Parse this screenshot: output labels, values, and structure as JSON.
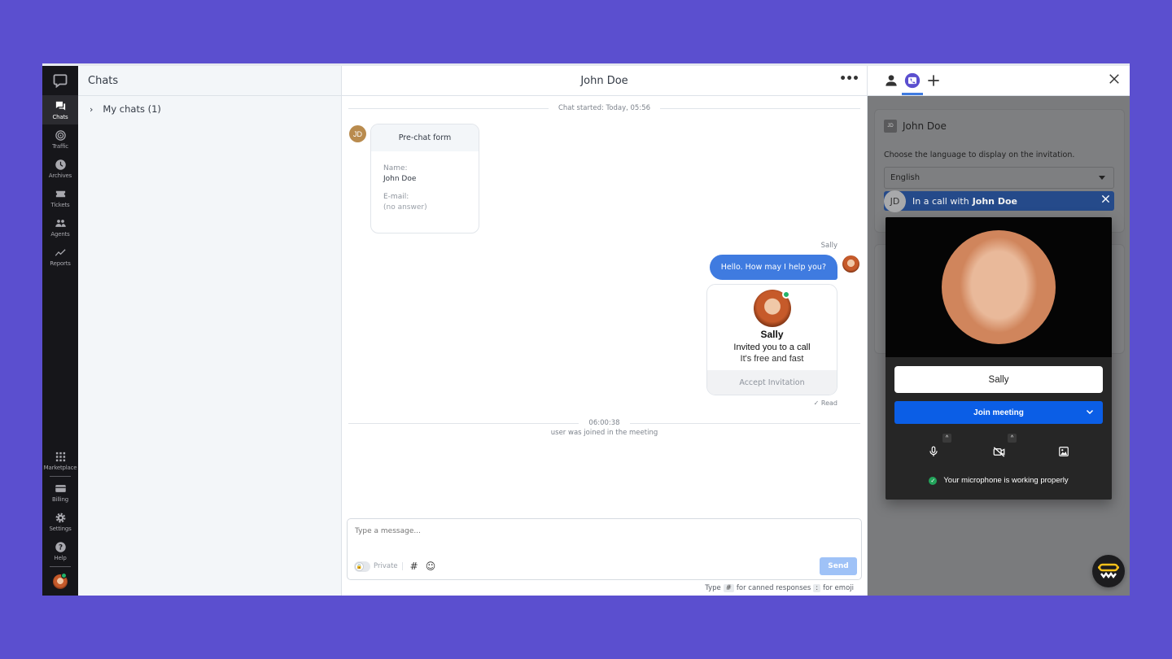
{
  "nav": {
    "items": [
      {
        "label": "Chats",
        "icon": "chats-icon",
        "active": true
      },
      {
        "label": "Traffic",
        "icon": "traffic-icon"
      },
      {
        "label": "Archives",
        "icon": "archives-icon"
      },
      {
        "label": "Tickets",
        "icon": "tickets-icon"
      },
      {
        "label": "Agents",
        "icon": "agents-icon"
      },
      {
        "label": "Reports",
        "icon": "reports-icon"
      }
    ],
    "bottom_items": [
      {
        "label": "Marketplace",
        "icon": "marketplace-icon"
      },
      {
        "label": "Billing",
        "icon": "billing-icon"
      },
      {
        "label": "Settings",
        "icon": "settings-icon"
      },
      {
        "label": "Help",
        "icon": "help-icon"
      }
    ]
  },
  "chats_list": {
    "title": "Chats",
    "groups": [
      {
        "label": "My chats (1)",
        "expanded": false
      }
    ]
  },
  "chat": {
    "title": "John Doe",
    "started": "Chat started: Today, 05:56",
    "visitor_initials": "JD",
    "prechat": {
      "title": "Pre-chat form",
      "fields": [
        {
          "label": "Name:",
          "value": "John Doe"
        },
        {
          "label": "E-mail:",
          "value": "(no answer)"
        }
      ]
    },
    "agent_name": "Sally",
    "message": "Hello. How may I help you?",
    "invite": {
      "name": "Sally",
      "line1": "Invited you to a call",
      "line2": "It's free and fast",
      "accept": "Accept Invitation"
    },
    "read_status": "✓ Read",
    "event_time": "06:00:38",
    "event_text": "user was joined in the meeting",
    "composer": {
      "placeholder": "Type a message...",
      "private_label": "Private",
      "send_label": "Send"
    },
    "hint": {
      "type": "Type",
      "hash_key": "#",
      "canned": "for canned responses",
      "colon_key": ":",
      "emoji": "for emoji"
    }
  },
  "panel": {
    "tabs": [
      "person-icon",
      "video-call-icon",
      "plus-icon"
    ],
    "active_tab": "video-call-icon",
    "visitor_initials": "JD",
    "visitor_name": "John Doe",
    "language_prompt": "Choose the language to display on the invitation.",
    "language_value": "English",
    "call_bar": {
      "initials": "JD",
      "prefix": "In a call with",
      "name": "John Doe"
    },
    "meeting": {
      "name_value": "Sally",
      "join_label": "Join meeting",
      "mic_status": "Your microphone is working properly"
    }
  },
  "colors": {
    "accent": "#3f7be0",
    "background": "#5b4fcf",
    "join_button": "#0b5ee6",
    "status_online": "#22b36a"
  }
}
